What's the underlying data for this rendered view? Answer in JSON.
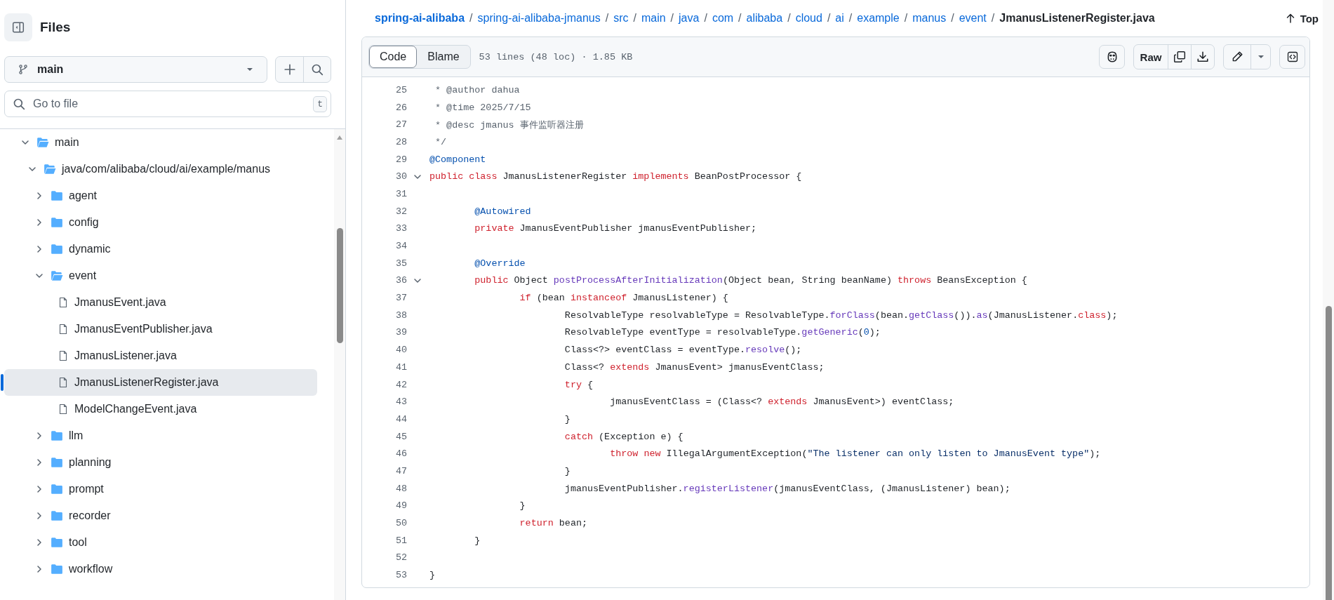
{
  "sidebar": {
    "title": "Files",
    "branch": "main",
    "search": {
      "placeholder": "Go to file",
      "shortcut": "t"
    },
    "tree": [
      {
        "label": "main",
        "kind": "folder",
        "expanded": true,
        "selected": false,
        "children": [
          {
            "label": "java/com/alibaba/cloud/ai/example/manus",
            "kind": "folder",
            "expanded": true,
            "selected": false,
            "children": [
              {
                "label": "agent",
                "kind": "folder",
                "expanded": false,
                "selected": false
              },
              {
                "label": "config",
                "kind": "folder",
                "expanded": false,
                "selected": false
              },
              {
                "label": "dynamic",
                "kind": "folder",
                "expanded": false,
                "selected": false
              },
              {
                "label": "event",
                "kind": "folder",
                "expanded": true,
                "selected": false,
                "children": [
                  {
                    "label": "JmanusEvent.java",
                    "kind": "file",
                    "selected": false
                  },
                  {
                    "label": "JmanusEventPublisher.java",
                    "kind": "file",
                    "selected": false
                  },
                  {
                    "label": "JmanusListener.java",
                    "kind": "file",
                    "selected": false
                  },
                  {
                    "label": "JmanusListenerRegister.java",
                    "kind": "file",
                    "selected": true
                  },
                  {
                    "label": "ModelChangeEvent.java",
                    "kind": "file",
                    "selected": false
                  }
                ]
              },
              {
                "label": "llm",
                "kind": "folder",
                "expanded": false,
                "selected": false
              },
              {
                "label": "planning",
                "kind": "folder",
                "expanded": false,
                "selected": false
              },
              {
                "label": "prompt",
                "kind": "folder",
                "expanded": false,
                "selected": false
              },
              {
                "label": "recorder",
                "kind": "folder",
                "expanded": false,
                "selected": false
              },
              {
                "label": "tool",
                "kind": "folder",
                "expanded": false,
                "selected": false
              },
              {
                "label": "workflow",
                "kind": "folder",
                "expanded": false,
                "selected": false
              }
            ]
          }
        ]
      }
    ]
  },
  "breadcrumb": {
    "separator": "/",
    "segments": [
      "spring-ai-alibaba",
      "spring-ai-alibaba-jmanus",
      "src",
      "main",
      "java",
      "com",
      "alibaba",
      "cloud",
      "ai",
      "example",
      "manus",
      "event",
      "JmanusListenerRegister.java"
    ]
  },
  "top_link": "Top",
  "file_header": {
    "tabs": [
      {
        "label": "Code",
        "selected": true
      },
      {
        "label": "Blame",
        "selected": false
      }
    ],
    "info": "53 lines (48 loc) · 1.85 KB",
    "raw_button": "Raw"
  },
  "code": [
    {
      "number": "25",
      "foldable": false,
      "tokens": [
        {
          "kind": "comment",
          "text": " * @author dahua"
        }
      ]
    },
    {
      "number": "26",
      "foldable": false,
      "tokens": [
        {
          "kind": "comment",
          "text": " * @time 2025/7/15"
        }
      ]
    },
    {
      "number": "27",
      "foldable": false,
      "tokens": [
        {
          "kind": "comment",
          "text": " * @desc jmanus 事件监听器注册"
        }
      ]
    },
    {
      "number": "28",
      "foldable": false,
      "tokens": [
        {
          "kind": "comment",
          "text": " */"
        }
      ]
    },
    {
      "number": "29",
      "foldable": false,
      "tokens": [
        {
          "kind": "annotation",
          "text": "@Component"
        }
      ]
    },
    {
      "number": "30",
      "foldable": true,
      "tokens": [
        {
          "kind": "keyword",
          "text": "public"
        },
        {
          "kind": "keyword",
          "text": " class"
        },
        {
          "kind": "plain",
          "text": " JmanusListenerRegister "
        },
        {
          "kind": "keyword",
          "text": "implements"
        },
        {
          "kind": "plain",
          "text": " BeanPostProcessor {"
        }
      ]
    },
    {
      "number": "31",
      "foldable": false
    },
    {
      "number": "32",
      "foldable": false,
      "tokens": [
        {
          "kind": "annotation",
          "text": "\t@Autowired"
        }
      ]
    },
    {
      "number": "33",
      "foldable": false,
      "tokens": [
        {
          "kind": "keyword",
          "text": "\tprivate"
        },
        {
          "kind": "plain",
          "text": " JmanusEventPublisher jmanusEventPublisher;"
        }
      ]
    },
    {
      "number": "34",
      "foldable": false
    },
    {
      "number": "35",
      "foldable": false,
      "tokens": [
        {
          "kind": "annotation",
          "text": "\t@Override"
        }
      ]
    },
    {
      "number": "36",
      "foldable": true,
      "tokens": [
        {
          "kind": "keyword",
          "text": "\tpublic"
        },
        {
          "kind": "plain",
          "text": " Object "
        },
        {
          "kind": "function",
          "text": "postProcessAfterInitialization"
        },
        {
          "kind": "plain",
          "text": "(Object bean, String beanName) "
        },
        {
          "kind": "keyword",
          "text": "throws"
        },
        {
          "kind": "plain",
          "text": " BeansException {"
        }
      ]
    },
    {
      "number": "37",
      "foldable": false,
      "tokens": [
        {
          "kind": "keyword",
          "text": "\t\tif"
        },
        {
          "kind": "plain",
          "text": " (bean "
        },
        {
          "kind": "keyword",
          "text": "instanceof"
        },
        {
          "kind": "plain",
          "text": " JmanusListener) {"
        }
      ]
    },
    {
      "number": "38",
      "foldable": false,
      "tokens": [
        {
          "kind": "plain",
          "text": "\t\t\tResolvableType resolvableType = ResolvableType."
        },
        {
          "kind": "function",
          "text": "forClass"
        },
        {
          "kind": "plain",
          "text": "(bean."
        },
        {
          "kind": "function",
          "text": "getClass"
        },
        {
          "kind": "plain",
          "text": "())."
        },
        {
          "kind": "function",
          "text": "as"
        },
        {
          "kind": "plain",
          "text": "(JmanusListener."
        },
        {
          "kind": "keyword",
          "text": "class"
        },
        {
          "kind": "plain",
          "text": ");"
        }
      ]
    },
    {
      "number": "39",
      "foldable": false,
      "tokens": [
        {
          "kind": "plain",
          "text": "\t\t\tResolvableType eventType = resolvableType."
        },
        {
          "kind": "function",
          "text": "getGeneric"
        },
        {
          "kind": "plain",
          "text": "("
        },
        {
          "kind": "number",
          "text": "0"
        },
        {
          "kind": "plain",
          "text": ");"
        }
      ]
    },
    {
      "number": "40",
      "foldable": false,
      "tokens": [
        {
          "kind": "plain",
          "text": "\t\t\tClass<?> eventClass = eventType."
        },
        {
          "kind": "function",
          "text": "resolve"
        },
        {
          "kind": "plain",
          "text": "();"
        }
      ]
    },
    {
      "number": "41",
      "foldable": false,
      "tokens": [
        {
          "kind": "plain",
          "text": "\t\t\tClass<? "
        },
        {
          "kind": "keyword",
          "text": "extends"
        },
        {
          "kind": "plain",
          "text": " JmanusEvent> jmanusEventClass;"
        }
      ]
    },
    {
      "number": "42",
      "foldable": false,
      "tokens": [
        {
          "kind": "keyword",
          "text": "\t\t\ttry"
        },
        {
          "kind": "plain",
          "text": " {"
        }
      ]
    },
    {
      "number": "43",
      "foldable": false,
      "tokens": [
        {
          "kind": "plain",
          "text": "\t\t\t\tjmanusEventClass = (Class<? "
        },
        {
          "kind": "keyword",
          "text": "extends"
        },
        {
          "kind": "plain",
          "text": " JmanusEvent>) eventClass;"
        }
      ]
    },
    {
      "number": "44",
      "foldable": false,
      "tokens": [
        {
          "kind": "plain",
          "text": "\t\t\t}"
        }
      ]
    },
    {
      "number": "45",
      "foldable": false,
      "tokens": [
        {
          "kind": "keyword",
          "text": "\t\t\tcatch"
        },
        {
          "kind": "plain",
          "text": " (Exception e) {"
        }
      ]
    },
    {
      "number": "46",
      "foldable": false,
      "tokens": [
        {
          "kind": "keyword",
          "text": "\t\t\t\tthrow"
        },
        {
          "kind": "keyword",
          "text": " new"
        },
        {
          "kind": "plain",
          "text": " IllegalArgumentException("
        },
        {
          "kind": "string",
          "text": "\"The listener can only listen to JmanusEvent type\""
        },
        {
          "kind": "plain",
          "text": ");"
        }
      ]
    },
    {
      "number": "47",
      "foldable": false,
      "tokens": [
        {
          "kind": "plain",
          "text": "\t\t\t}"
        }
      ]
    },
    {
      "number": "48",
      "foldable": false,
      "tokens": [
        {
          "kind": "plain",
          "text": "\t\t\tjmanusEventPublisher."
        },
        {
          "kind": "function",
          "text": "registerListener"
        },
        {
          "kind": "plain",
          "text": "(jmanusEventClass, (JmanusListener) bean);"
        }
      ]
    },
    {
      "number": "49",
      "foldable": false,
      "tokens": [
        {
          "kind": "plain",
          "text": "\t\t}"
        }
      ]
    },
    {
      "number": "50",
      "foldable": false,
      "tokens": [
        {
          "kind": "keyword",
          "text": "\t\treturn"
        },
        {
          "kind": "plain",
          "text": " bean;"
        }
      ]
    },
    {
      "number": "51",
      "foldable": false,
      "tokens": [
        {
          "kind": "plain",
          "text": "\t}"
        }
      ]
    },
    {
      "number": "52",
      "foldable": false
    },
    {
      "number": "53",
      "foldable": false,
      "tokens": [
        {
          "kind": "plain",
          "text": "}"
        }
      ]
    }
  ]
}
